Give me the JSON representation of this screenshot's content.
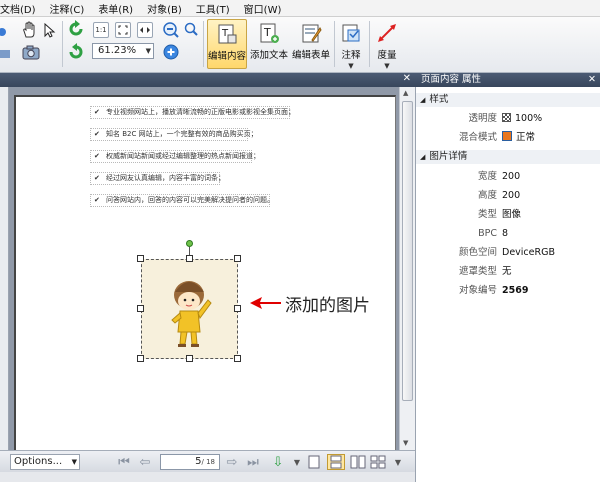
{
  "menu": [
    "文档(D)",
    "注释(C)",
    "表单(R)",
    "对象(B)",
    "工具(T)",
    "窗口(W)"
  ],
  "toolbar": {
    "zoom_value": "61.23%",
    "buttons": [
      {
        "label": "编辑内容",
        "active": true
      },
      {
        "label": "添加文本"
      },
      {
        "label": "编辑表单"
      },
      {
        "label": "注释"
      },
      {
        "label": "度量"
      }
    ],
    "zoom_small": [
      "1:1",
      "fit-page",
      "fit-width"
    ]
  },
  "document": {
    "bullets": [
      "专业视频网站上，播放清晰流畅的正版电影或影视全集页面；",
      "知名 B2C 网站上，一个完整有效的商品购买页；",
      "权威新闻站新闻或经过编辑整理的热点新闻报道；",
      "经过网友认真编辑，内容丰富的词条；",
      "问答网站内，回答的内容可以完美解决提问者的问题。"
    ],
    "annotation": "添加的图片"
  },
  "bottom": {
    "options": "Options...",
    "page_current": "5",
    "page_total": "/ 18"
  },
  "properties": {
    "title": "页面内容 属性",
    "sections": {
      "style": "样式",
      "details": "图片详情"
    },
    "style_rows": [
      {
        "key": "透明度",
        "value": "100%"
      },
      {
        "key": "混合模式",
        "value": "正常"
      }
    ],
    "detail_rows": [
      {
        "key": "宽度",
        "value": "200"
      },
      {
        "key": "高度",
        "value": "200"
      },
      {
        "key": "类型",
        "value": "图像"
      },
      {
        "key": "BPC",
        "value": "8"
      },
      {
        "key": "颜色空间",
        "value": "DeviceRGB"
      },
      {
        "key": "遮罩类型",
        "value": "无"
      },
      {
        "key": "对象编号",
        "value": "2569"
      }
    ]
  },
  "colors": {
    "panel_header": "#3f4e66",
    "active_button": "#ffd76b",
    "annotation_arrow": "#e00000"
  }
}
